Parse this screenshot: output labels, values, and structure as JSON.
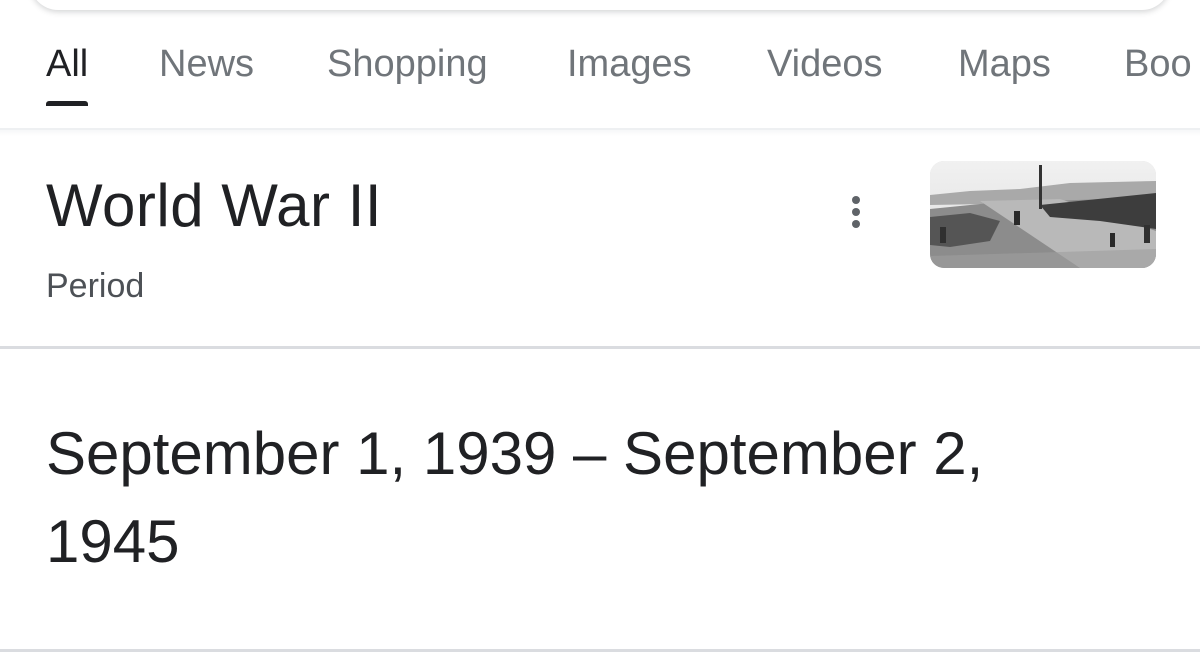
{
  "tabs": [
    {
      "label": "All",
      "active": true
    },
    {
      "label": "News",
      "active": false
    },
    {
      "label": "Shopping",
      "active": false
    },
    {
      "label": "Images",
      "active": false
    },
    {
      "label": "Videos",
      "active": false
    },
    {
      "label": "Maps",
      "active": false
    },
    {
      "label": "Boo",
      "active": false
    }
  ],
  "entity": {
    "title": "World War II",
    "subtitle": "Period",
    "more_icon": "more-vert-icon",
    "thumbnail_desc": "black-and-white war photo"
  },
  "answer": {
    "text": "September 1, 1939 – September 2, 1945"
  },
  "colors": {
    "text_primary": "#202124",
    "text_secondary": "#70757a",
    "divider": "#dadce0"
  }
}
